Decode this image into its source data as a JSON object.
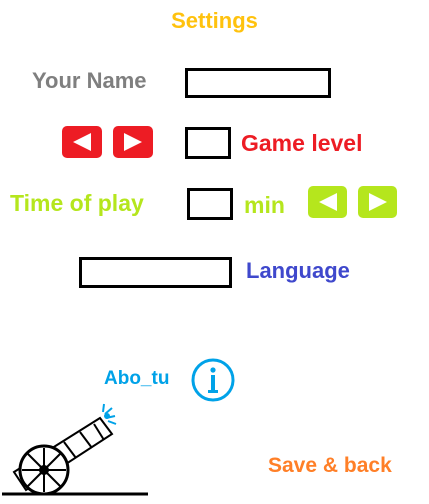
{
  "title": "Settings",
  "name_field": {
    "label": "Your Name",
    "value": ""
  },
  "game_level": {
    "label": "Game level",
    "value": "",
    "decrease": "◀",
    "increase": "▶"
  },
  "time_of_play": {
    "label": "Time of play",
    "value": "",
    "unit": "min",
    "decrease": "◀",
    "increase": "▶"
  },
  "language": {
    "label": "Language",
    "value": ""
  },
  "about": {
    "label": "Abo_tu"
  },
  "save_back": {
    "label": "Save & back"
  },
  "icons": {
    "info": "info-icon",
    "cannon": "cannon-icon"
  },
  "colors": {
    "title": "#ffc20e",
    "name_label": "#7f7f7f",
    "game_level": "#ed1c24",
    "time_of_play": "#b5e61d",
    "language": "#3f48cc",
    "about": "#00a2e8",
    "save_back": "#ff7f27"
  }
}
